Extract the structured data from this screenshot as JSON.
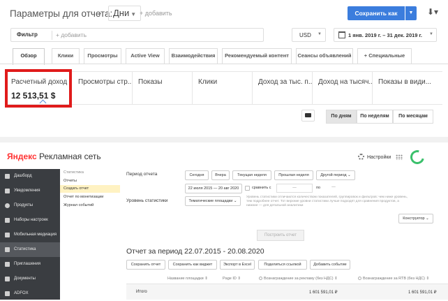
{
  "top": {
    "title": "Параметры для отчета:",
    "chevron": "›",
    "period_select": "Дни",
    "add_link": "+ добавить",
    "save_button": "Сохранить как",
    "filter_label": "Фильтр",
    "filter_placeholder": "+ добавить",
    "currency": "USD",
    "date_range": "1 янв. 2019 г. – 31 дек. 2019 г.",
    "tabs": [
      "Обзор",
      "Клики",
      "Просмотры",
      "Active View",
      "Взаимодействия",
      "Рекомендуемый контент",
      "Сеансы объявлений",
      "+ Специальные"
    ],
    "metrics": [
      {
        "label": "Расчетный доход",
        "value": "12 513,51 $"
      },
      {
        "label": "Просмотры стр..."
      },
      {
        "label": "Показы"
      },
      {
        "label": "Клики"
      },
      {
        "label": "Доход за тыс. п..."
      },
      {
        "label": "Доход на тысяч..."
      },
      {
        "label": "Показы в види..."
      }
    ],
    "granularity": [
      "По дням",
      "По неделям",
      "По месяцам"
    ],
    "highlight_color": "#e01b1b",
    "accent_color": "#3b7ddd"
  },
  "bottom": {
    "logo_brand": "Яндекс",
    "logo_rest": "Рекламная сеть",
    "settings": "Настройки",
    "sidebar": [
      {
        "label": "Дашборд",
        "icon": "dashboard-icon"
      },
      {
        "label": "Уведомления",
        "icon": "bell-icon"
      },
      {
        "label": "Продукты",
        "icon": "products-icon"
      },
      {
        "label": "Наборы настроек",
        "icon": "settings-set-icon"
      },
      {
        "label": "Мобильная медиация",
        "icon": "mediation-icon"
      },
      {
        "label": "Статистика",
        "icon": "stats-icon"
      },
      {
        "label": "Приглашения",
        "icon": "invite-icon"
      },
      {
        "label": "Документы",
        "icon": "docs-icon"
      },
      {
        "label": "ADFOX",
        "icon": "adfox-icon"
      }
    ],
    "submenu": [
      "Статистика",
      "Отчеты",
      "Создать отчет",
      "Отчет по монетизации",
      "Журнал событий"
    ],
    "period_label": "Период отчета",
    "period_buttons": [
      "Сегодня",
      "Вчера",
      "Текущая неделя",
      "Прошлая неделя",
      "Другой период ⌄"
    ],
    "date_range": "22 июля 2015 — 20 авг 2020",
    "compare_label": "сравнить с",
    "compare_dash": "—",
    "compare_to": "по",
    "compare_to_dash": "—",
    "stat_level_label": "Уровень статистики",
    "stat_level_value": "Тематические площадки ⌄",
    "help_text": "Уровень статистики отличаются количеством показателей, группировок и фильтров: чем ниже уровень, тем подробнее отчет. Тот верхние уровни статистики лучше подходят для сравнения продуктов, а нижние — для детальной аналитики",
    "constructor": "Конструктор ⌄",
    "build_button": "Построить отчет",
    "report_title": "Отчет за период 22.07.2015 - 20.08.2020",
    "actions": [
      "Сохранить отчет",
      "Сохранить как виджет",
      "Экспорт в Excel",
      "Поделиться ссылкой",
      "Добавить событие"
    ],
    "columns": [
      "Название площадки ⇕",
      "Page ID ⇕",
      "Вознаграждение за рекламу (без НДС) ⇕",
      "Вознаграждение за RTB (без НДС) ⇕"
    ],
    "total_label": "Итого",
    "total_ad": "1 601 591,01 ₽",
    "total_rtb": "1 601 591,01 ₽"
  }
}
